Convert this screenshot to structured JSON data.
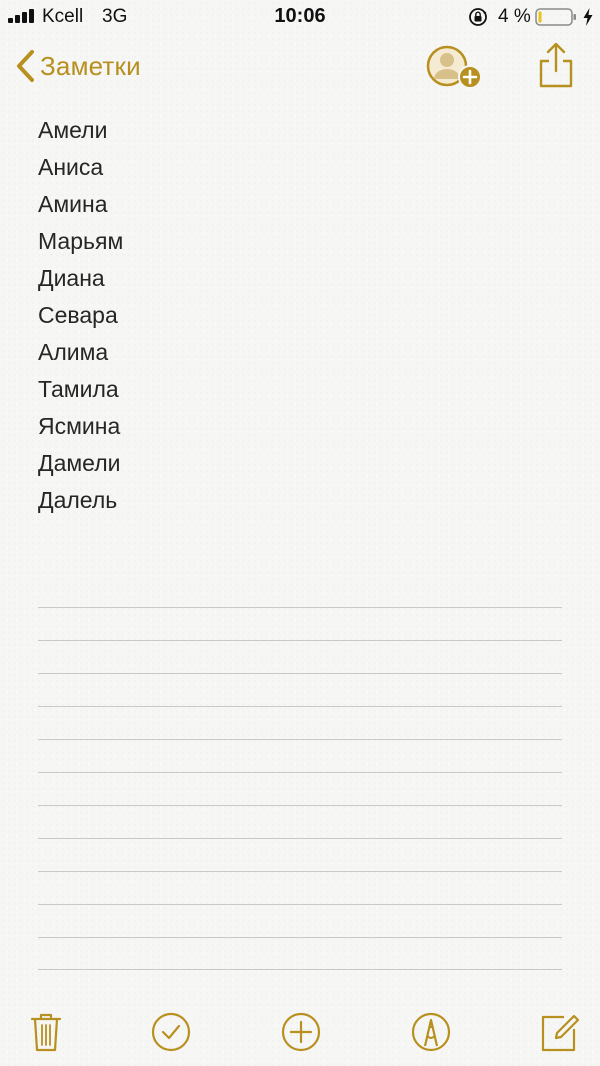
{
  "status_bar": {
    "carrier": "Kcell",
    "network": "3G",
    "time": "10:06",
    "battery_percent": "4 %",
    "icons": [
      "signal-bars-icon",
      "orientation-lock-icon",
      "battery-icon",
      "charging-bolt-icon"
    ]
  },
  "nav": {
    "back_label": "Заметки",
    "icons": [
      "back-chevron-icon",
      "add-people-icon",
      "share-icon"
    ]
  },
  "note": {
    "lines": [
      "Амели",
      "Аниса",
      "Амина",
      "Марьям",
      "Диана",
      "Севара",
      "Алима",
      "Тамила",
      "Ясмина",
      "Дамели",
      "Далель"
    ]
  },
  "toolbar": {
    "icons": [
      "trash-icon",
      "checklist-icon",
      "add-icon",
      "markup-icon",
      "compose-icon"
    ]
  },
  "colors": {
    "accent": "#b8901f",
    "paper": "#f6f6f4",
    "rule_line": "#c9c9c6",
    "text": "#262626"
  }
}
